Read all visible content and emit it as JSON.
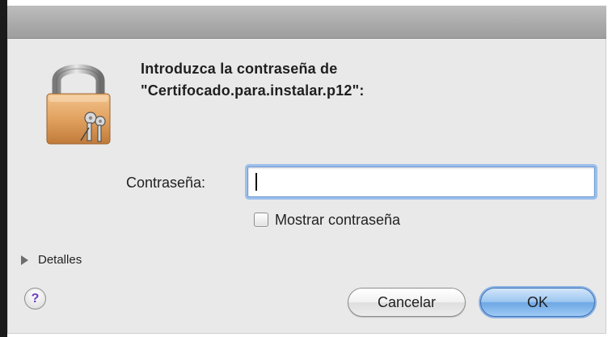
{
  "dialog": {
    "message_line1": "Introduzca la contraseña de",
    "message_line2": "\"Certifocado.para.instalar.p12\":",
    "password_label": "Contraseña:",
    "password_value": "",
    "show_password_label": "Mostrar contraseña",
    "show_password_checked": false,
    "details_label": "Detalles",
    "help_label": "?",
    "cancel_label": "Cancelar",
    "ok_label": "OK"
  },
  "colors": {
    "dialog_background": "#e9e9e9",
    "titlebar": "#a9a9a9",
    "default_button": "#8bbcef",
    "focus_ring": "#9dbfeb",
    "lock_body": "#e2a25f"
  },
  "icons": {
    "lock": "keychain-lock-icon",
    "help": "help-icon",
    "disclosure": "disclosure-triangle-icon"
  }
}
